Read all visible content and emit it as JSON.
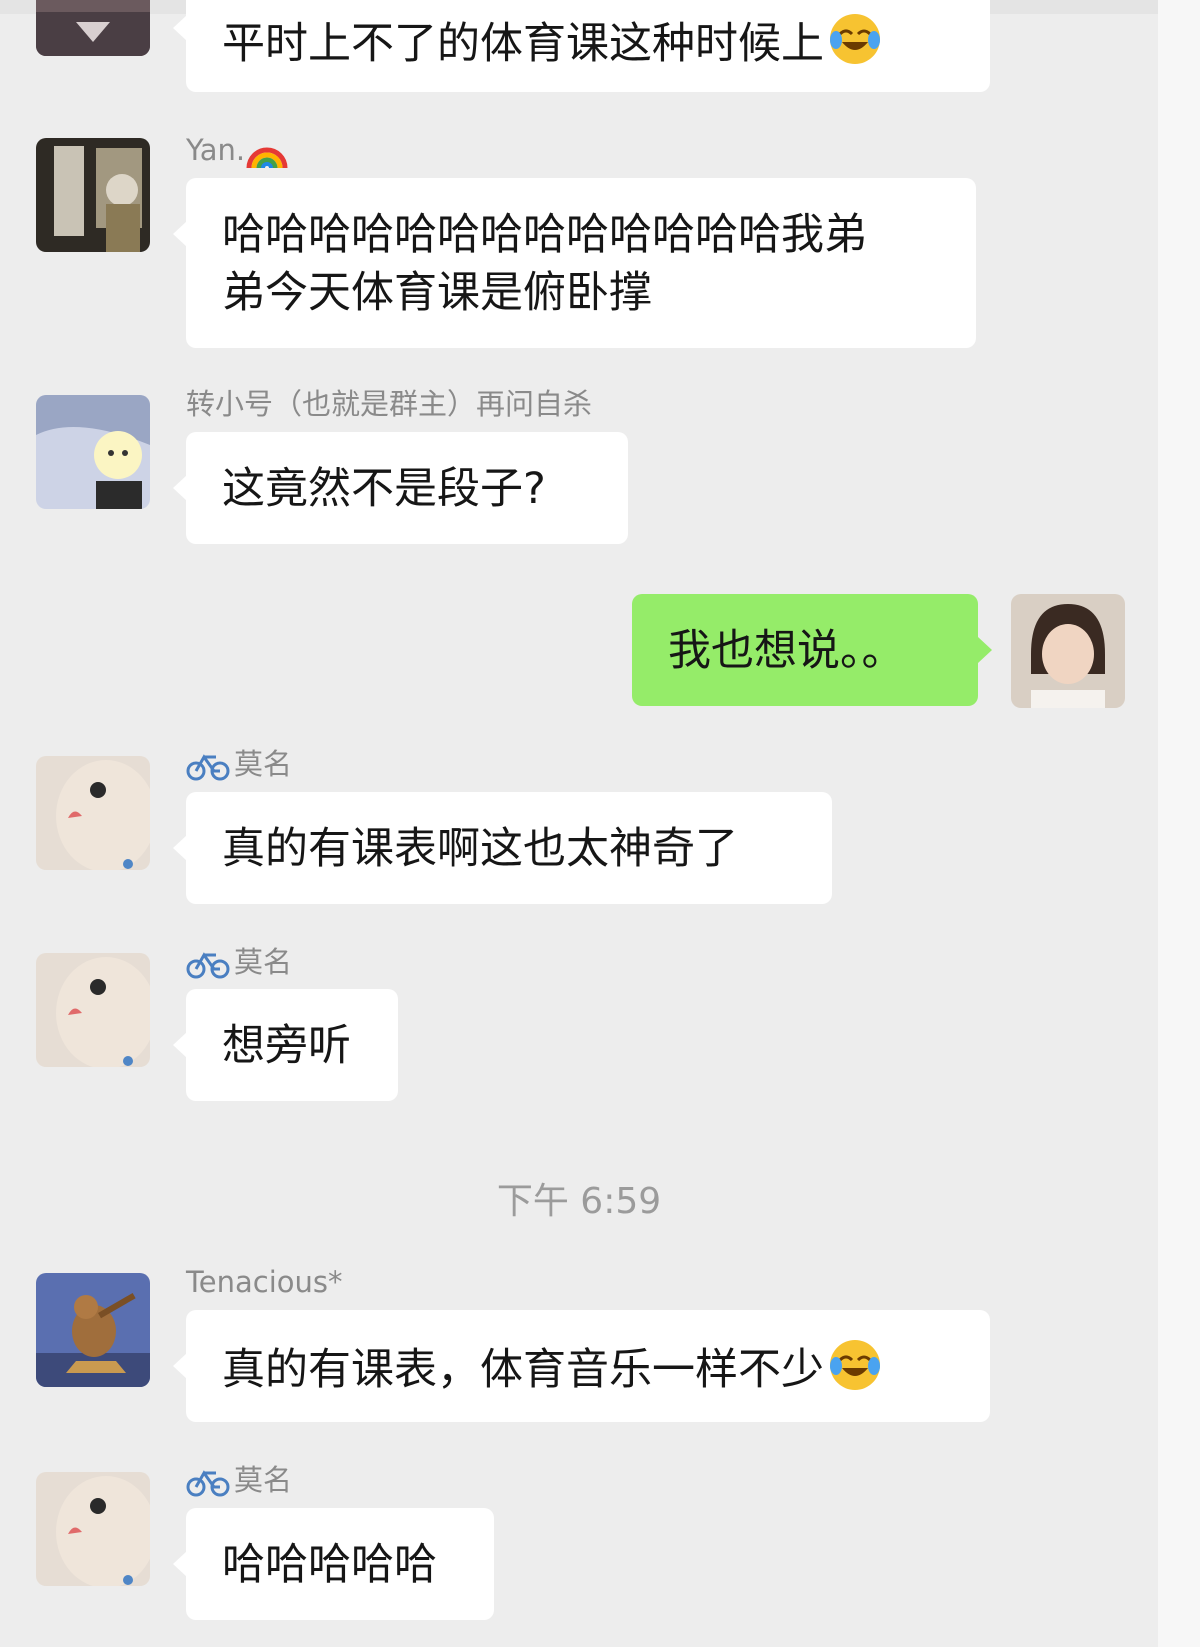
{
  "conversation": {
    "timestamp": "下午 6:59",
    "messages": [
      {
        "text": "平时上不了的体育课这种时候上",
        "emoji": "crying-laughing-emoji"
      },
      {
        "sender": "Yan.",
        "sender_emoji": "rainbow-emoji",
        "lines": [
          "哈哈哈哈哈哈哈哈哈哈哈哈哈我弟",
          "弟今天体育课是俯卧撑"
        ]
      },
      {
        "sender": "转小号（也就是群主）再问自杀",
        "text": "这竟然不是段子?"
      },
      {
        "text": "我也想说。。",
        "mine": true
      },
      {
        "sender": "莫名",
        "sender_emoji": "bicycle-emoji",
        "text": "真的有课表啊这也太神奇了"
      },
      {
        "sender": "莫名",
        "sender_emoji": "bicycle-emoji",
        "text": "想旁听"
      },
      {
        "sender": "Tenacious*",
        "text": "真的有课表，体育音乐一样不少",
        "emoji": "crying-laughing-emoji"
      },
      {
        "sender": "莫名",
        "sender_emoji": "bicycle-emoji",
        "text": "哈哈哈哈哈"
      }
    ]
  },
  "colors": {
    "background": "#ededed",
    "bubble_other": "#ffffff",
    "bubble_mine": "#95ec69",
    "sender_name": "#8a8a8a",
    "timestamp": "#9b9b9b"
  }
}
